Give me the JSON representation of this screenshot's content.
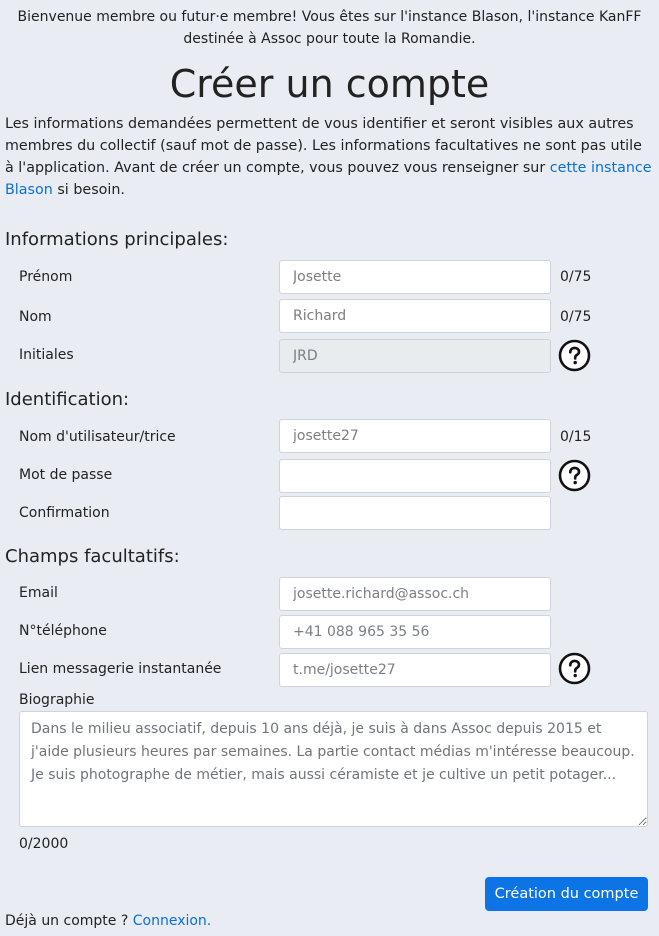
{
  "banner": {
    "line1": "Bienvenue membre ou futur·e membre! Vous êtes sur l'instance Blason, l'instance KanFF",
    "line2": "destinée à Assoc pour toute la Romandie."
  },
  "title": "Créer un compte",
  "intro": {
    "text_before": "Les informations demandées permettent de vous identifier et seront visibles aux autres membres du collectif (sauf mot de passe). Les informations facultatives ne sont pas utile à l'application. Avant de créer un compte, vous pouvez vous renseigner sur ",
    "link": "cette instance Blason",
    "text_after": " si besoin."
  },
  "sections": {
    "main": "Informations principales:",
    "identification": "Identification:",
    "optional": "Champs facultatifs:"
  },
  "fields": {
    "firstname": {
      "label": "Prénom",
      "placeholder": "Josette",
      "counter": "0/75"
    },
    "lastname": {
      "label": "Nom",
      "placeholder": "Richard",
      "counter": "0/75"
    },
    "initials": {
      "label": "Initiales",
      "placeholder": "JRD"
    },
    "username": {
      "label": "Nom d'utilisateur/trice",
      "placeholder": "josette27",
      "counter": "0/15"
    },
    "password": {
      "label": "Mot de passe",
      "placeholder": ""
    },
    "confirmation": {
      "label": "Confirmation",
      "placeholder": ""
    },
    "email": {
      "label": "Email",
      "placeholder": "josette.richard@assoc.ch"
    },
    "phone": {
      "label": "N°téléphone",
      "placeholder": "+41 088 965 35 56"
    },
    "messaging": {
      "label": "Lien messagerie instantanée",
      "placeholder": "t.me/josette27"
    },
    "bio": {
      "label": "Biographie",
      "placeholder": "Dans le milieu associatif, depuis 10 ans déjà, je suis à dans Assoc depuis 2015 et j'aide plusieurs heures par semaines. La partie contact médias m'intéresse beaucoup. Je suis photographe de métier, mais aussi céramiste et je cultive un petit potager...",
      "counter": "0/2000"
    }
  },
  "icons": {
    "help": "question-circle-icon"
  },
  "actions": {
    "submit": "Création du compte"
  },
  "footer": {
    "text": "Déjà un compte ? ",
    "link": "Connexion."
  },
  "colors": {
    "accent": "#0d74e6",
    "link": "#0b6fd6",
    "background": "#e9edf3"
  }
}
